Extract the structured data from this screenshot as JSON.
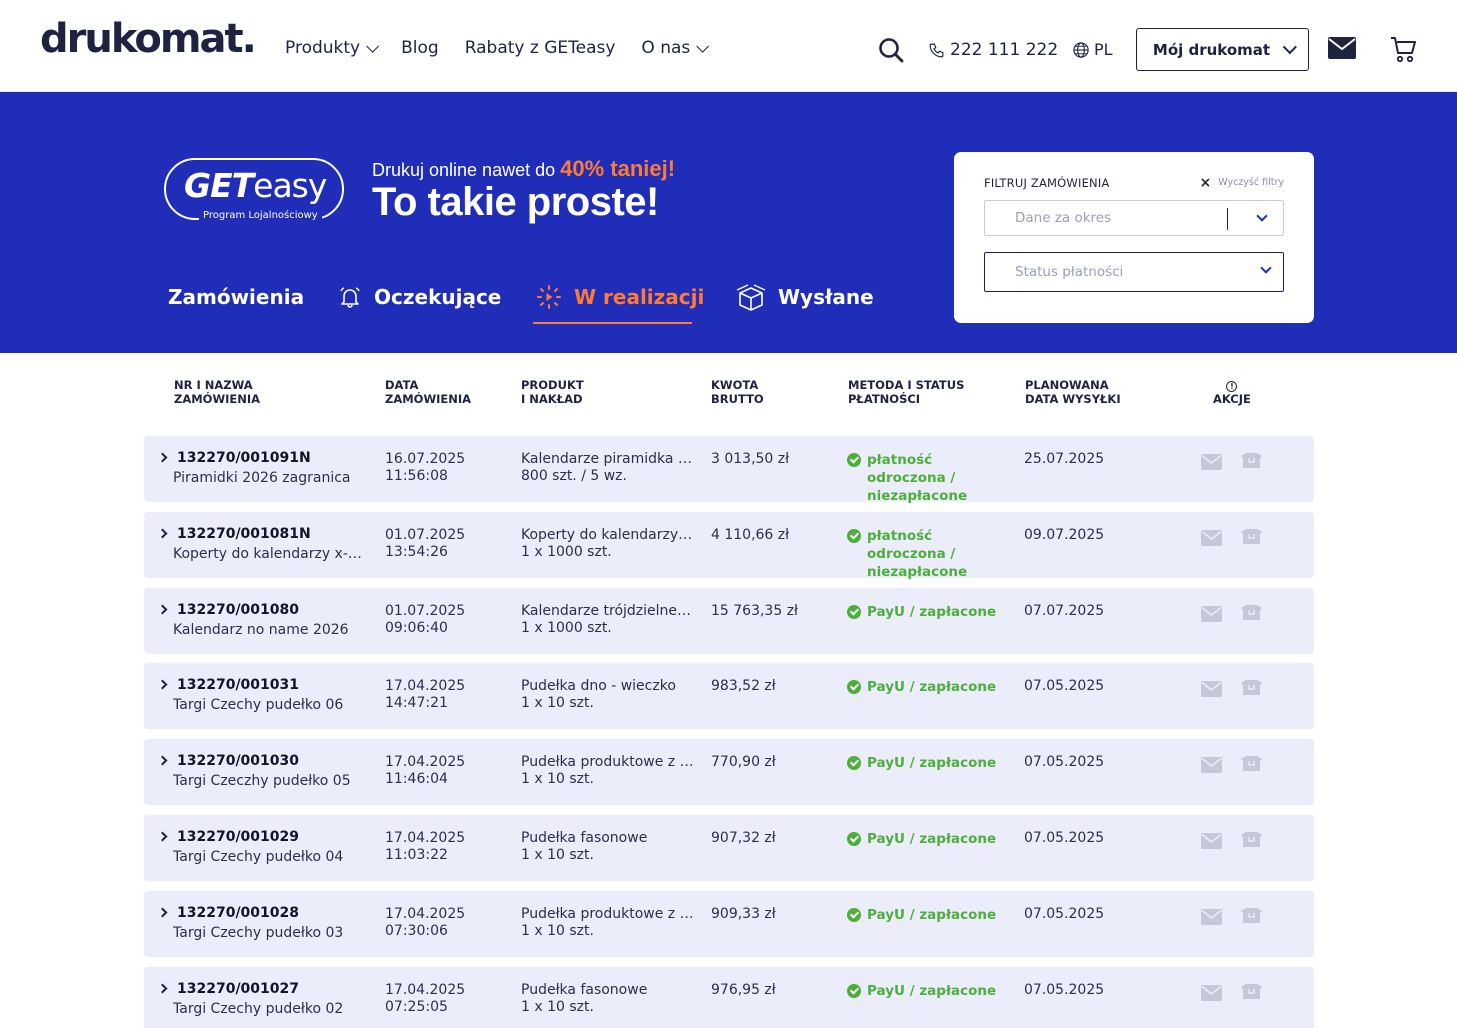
{
  "header": {
    "logo": "drukomat.",
    "nav": [
      {
        "label": "Produkty",
        "has_dropdown": true
      },
      {
        "label": "Blog",
        "has_dropdown": false
      },
      {
        "label": "Rabaty z GETeasy",
        "has_dropdown": false
      },
      {
        "label": "O nas",
        "has_dropdown": true
      }
    ],
    "phone": "222 111 222",
    "language": "PL",
    "account_label": "Mój drukomat",
    "icons": [
      "search-icon",
      "phone-icon",
      "globe-icon",
      "chevron-down-icon",
      "mail-icon",
      "cart-icon"
    ]
  },
  "hero": {
    "badge_brand_bold": "GET",
    "badge_brand_light": "easy",
    "badge_sub": "Program Lojalnościowy",
    "promo_prefix": "Drukuj online nawet do ",
    "promo_highlight": "40% taniej!",
    "promo_title": "To takie proste!",
    "tabs": [
      {
        "label": "Zamówienia",
        "icon": "",
        "active": false
      },
      {
        "label": "Oczekujące",
        "icon": "bell-icon",
        "active": false
      },
      {
        "label": "W realizacji",
        "icon": "progress-icon",
        "active": true
      },
      {
        "label": "Wysłane",
        "icon": "package-icon",
        "active": false
      }
    ]
  },
  "filter": {
    "title": "FILTRUJ ZAMÓWIENIA",
    "clear_label": "Wyczyść filtry",
    "period_placeholder": "Dane za okres",
    "status_placeholder": "Status płatności"
  },
  "table": {
    "headers": {
      "nr": "NR I NAZWA\nZAMÓWIENIA",
      "date": "DATA\nZAMÓWIENIA",
      "product": "PRODUKT\nI NAKŁAD",
      "amount": "KWOTA\nBRUTTO",
      "payment": "METODA I STATUS\nPŁATNOŚCI",
      "ship": "PLANOWANA\nDATA WYSYŁKI",
      "info_glyph": "!",
      "actions": "AKCJE"
    },
    "rows": [
      {
        "nr": "132270/001091N",
        "name": "Piramidki 2026 zagranica",
        "date": "16.07.2025",
        "time": "11:56:08",
        "product": "Kalendarze piramidka pr...",
        "qty": "800 szt. / 5 wz.",
        "amount": "3 013,50 zł",
        "payment": "płatność odroczona / niezapłacone",
        "ship": "25.07.2025"
      },
      {
        "nr": "132270/001081N",
        "name": "Koperty do kalendarzy x-dzi...",
        "date": "01.07.2025",
        "time": "13:54:26",
        "product": "Koperty do kalendarzy x...",
        "qty": "1 x 1000 szt.",
        "amount": "4 110,66 zł",
        "payment": "płatność odroczona / niezapłacone",
        "ship": "09.07.2025"
      },
      {
        "nr": "132270/001080",
        "name": "Kalendarz no name 2026",
        "date": "01.07.2025",
        "time": "09:06:40",
        "product": "Kalendarze trójdzielne P...",
        "qty": "1 x 1000 szt.",
        "amount": "15 763,35 zł",
        "payment": "PayU / zapłacone",
        "ship": "07.07.2025"
      },
      {
        "nr": "132270/001031",
        "name": "Targi Czechy pudełko 06",
        "date": "17.04.2025",
        "time": "14:47:21",
        "product": "Pudełka dno - wieczko",
        "qty": "1 x 10 szt.",
        "amount": "983,52 zł",
        "payment": "PayU / zapłacone",
        "ship": "07.05.2025"
      },
      {
        "nr": "132270/001030",
        "name": "Targi Czeczhy pudełko 05",
        "date": "17.04.2025",
        "time": "11:46:04",
        "product": "Pudełka produktowe z z...",
        "qty": "1 x 10 szt.",
        "amount": "770,90 zł",
        "payment": "PayU / zapłacone",
        "ship": "07.05.2025"
      },
      {
        "nr": "132270/001029",
        "name": "Targi Czechy pudełko 04",
        "date": "17.04.2025",
        "time": "11:03:22",
        "product": "Pudełka fasonowe",
        "qty": "1 x 10 szt.",
        "amount": "907,32 zł",
        "payment": "PayU / zapłacone",
        "ship": "07.05.2025"
      },
      {
        "nr": "132270/001028",
        "name": "Targi Czechy pudełko 03",
        "date": "17.04.2025",
        "time": "07:30:06",
        "product": "Pudełka produktowe z z...",
        "qty": "1 x 10 szt.",
        "amount": "909,33 zł",
        "payment": "PayU / zapłacone",
        "ship": "07.05.2025"
      },
      {
        "nr": "132270/001027",
        "name": "Targi Czechy pudełko 02",
        "date": "17.04.2025",
        "time": "07:25:05",
        "product": "Pudełka fasonowe",
        "qty": "1 x 10 szt.",
        "amount": "976,95 zł",
        "payment": "PayU / zapłacone",
        "ship": "07.05.2025"
      }
    ],
    "row_action_icons": [
      "mail-icon",
      "package-icon"
    ]
  },
  "colors": {
    "brand_blue": "#1f2db8",
    "accent_orange": "#ff7b35",
    "paid_green": "#4cae3b",
    "row_bg": "#ecedfa",
    "text_dark": "#1d2340"
  }
}
